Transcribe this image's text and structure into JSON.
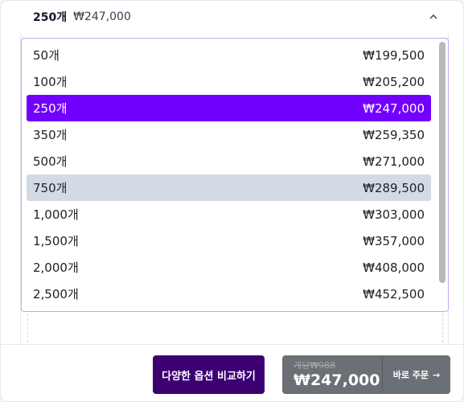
{
  "header": {
    "quantity": "250개",
    "price": "₩247,000"
  },
  "options": [
    {
      "qty": "50개",
      "price": "₩199,500",
      "state": "normal"
    },
    {
      "qty": "100개",
      "price": "₩205,200",
      "state": "normal"
    },
    {
      "qty": "250개",
      "price": "₩247,000",
      "state": "selected"
    },
    {
      "qty": "350개",
      "price": "₩259,350",
      "state": "normal"
    },
    {
      "qty": "500개",
      "price": "₩271,000",
      "state": "normal"
    },
    {
      "qty": "750개",
      "price": "₩289,500",
      "state": "hover"
    },
    {
      "qty": "1,000개",
      "price": "₩303,000",
      "state": "normal"
    },
    {
      "qty": "1,500개",
      "price": "₩357,000",
      "state": "normal"
    },
    {
      "qty": "2,000개",
      "price": "₩408,000",
      "state": "normal"
    },
    {
      "qty": "2,500개",
      "price": "₩452,500",
      "state": "normal"
    }
  ],
  "footer": {
    "compare_label": "다양한 옵션 비교하기",
    "unit_label": "개당",
    "unit_price": "₩988",
    "total_price": "₩247,000",
    "buy_label": "바로 주문",
    "buy_arrow": "→"
  },
  "colors": {
    "selected": "#7200ff",
    "hover": "#d3dae6",
    "compare_button": "#3d0073",
    "order_group": "#6b7076"
  },
  "icons": {
    "collapse": "chevron-up-icon",
    "buy_arrow": "arrow-right-icon"
  }
}
